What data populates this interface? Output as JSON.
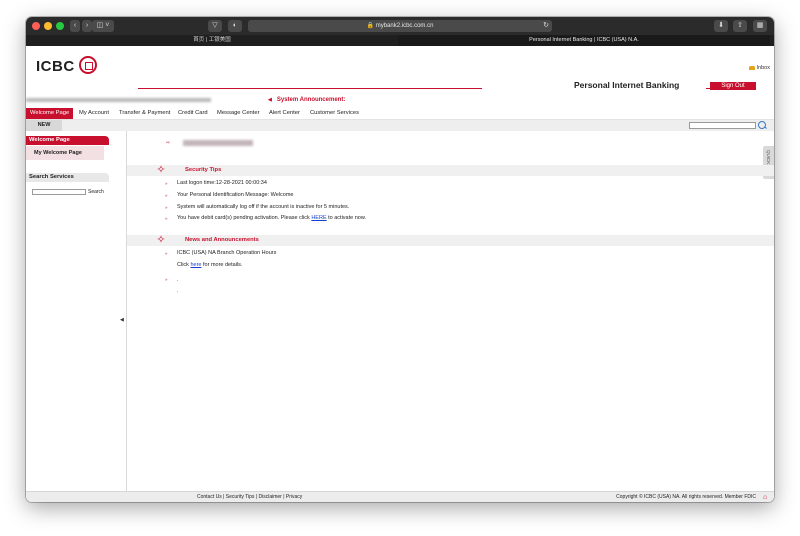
{
  "browser": {
    "url": "mybank2.icbc.com.cn",
    "tabs": [
      {
        "label": "首页 | 工银美国"
      },
      {
        "label": "Personal Internet Banking | ICBC (USA) N.A."
      }
    ]
  },
  "header": {
    "logo": "ICBC",
    "inbox": "Inbox",
    "title": "Personal Internet Banking",
    "signout": "Sign Out",
    "announcement": "System Announcement:"
  },
  "nav": {
    "items": [
      {
        "label": "Welcome Page"
      },
      {
        "label": "My Account"
      },
      {
        "label": "Transfer & Payment"
      },
      {
        "label": "Credit Card"
      },
      {
        "label": "Message Center"
      },
      {
        "label": "Alert Center"
      },
      {
        "label": "Customer Services"
      }
    ],
    "new_label": "NEW"
  },
  "sidebar": {
    "welcome_header": "Welcome Page",
    "welcome_item": "My Welcome Page",
    "search_header": "Search Services",
    "search_button": "Search"
  },
  "content": {
    "quick_tab": "QUICK FAQ",
    "security": {
      "title": "Security Tips",
      "lines": [
        "Last logon time:12-28-2021 00:00:34",
        "Your Personal Identification Message: Welcome",
        "System will automatically log off if the account is inactive for 5 minutes.",
        "You have debit card(s) pending activation. Please click "
      ],
      "here_link": "HERE",
      "after_link": " to activate now."
    },
    "news": {
      "title": "News and Announcements",
      "line1": "ICBC  (USA)  NA Branch Operation Hours",
      "click": "Click ",
      "here": "here",
      "rest": " for more details.",
      "dot": "."
    }
  },
  "footer": {
    "links": "Contact Us | Security Tips | Disclaimer | Privacy",
    "copyright": "Copyright © ICBC (USA) NA.  All rights reserved.  Member FDIC"
  },
  "colors": {
    "brand": "#c8102e",
    "link": "#1a3fd0"
  }
}
